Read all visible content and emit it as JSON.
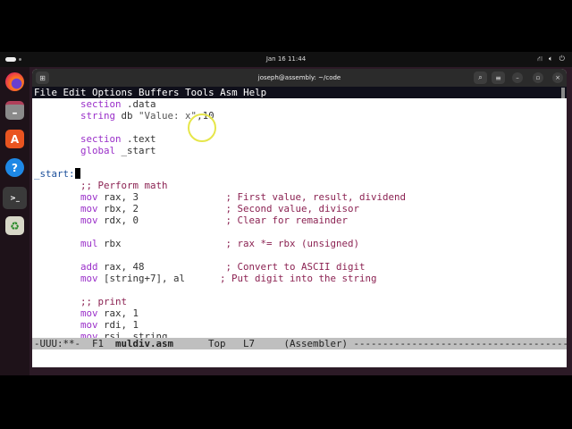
{
  "top_panel": {
    "clock": "Jan 16  11:44",
    "network_icon": "network-icon",
    "volume_icon": "volume-icon",
    "power_icon": "power-icon"
  },
  "dock": [
    {
      "name": "firefox"
    },
    {
      "name": "files"
    },
    {
      "name": "app-center"
    },
    {
      "name": "help"
    },
    {
      "name": "terminal"
    },
    {
      "name": "trash"
    }
  ],
  "window": {
    "title": "joseph@assembly: ~/code"
  },
  "menu": [
    "File",
    "Edit",
    "Options",
    "Buffers",
    "Tools",
    "Asm",
    "Help"
  ],
  "code": [
    [
      {
        "t": "        "
      },
      {
        "t": "section",
        "c": "kw"
      },
      {
        "t": " .data"
      }
    ],
    [
      {
        "t": "        "
      },
      {
        "t": "string",
        "c": "kw"
      },
      {
        "t": " db "
      },
      {
        "t": "\"Value: x\"",
        "c": "st"
      },
      {
        "t": ",10"
      }
    ],
    [],
    [
      {
        "t": "        "
      },
      {
        "t": "section",
        "c": "kw"
      },
      {
        "t": " .text"
      }
    ],
    [
      {
        "t": "        "
      },
      {
        "t": "global",
        "c": "kw"
      },
      {
        "t": " _start"
      }
    ],
    [],
    [
      {
        "t": "_start:",
        "c": "lb"
      }
    ],
    [
      {
        "t": "        "
      },
      {
        "t": ";; Perform math",
        "c": "cm"
      }
    ],
    [
      {
        "t": "        "
      },
      {
        "t": "mov",
        "c": "kw"
      },
      {
        "t": " rax, 3               "
      },
      {
        "t": "; First value, result, dividend",
        "c": "cm"
      }
    ],
    [
      {
        "t": "        "
      },
      {
        "t": "mov",
        "c": "kw"
      },
      {
        "t": " rbx, 2               "
      },
      {
        "t": "; Second value, divisor",
        "c": "cm"
      }
    ],
    [
      {
        "t": "        "
      },
      {
        "t": "mov",
        "c": "kw"
      },
      {
        "t": " rdx, 0               "
      },
      {
        "t": "; Clear for remainder",
        "c": "cm"
      }
    ],
    [],
    [
      {
        "t": "        "
      },
      {
        "t": "mul",
        "c": "kw"
      },
      {
        "t": " rbx                  "
      },
      {
        "t": "; rax *= rbx (unsigned)",
        "c": "cm"
      }
    ],
    [],
    [
      {
        "t": "        "
      },
      {
        "t": "add",
        "c": "kw"
      },
      {
        "t": " rax, 48              "
      },
      {
        "t": "; Convert to ASCII digit",
        "c": "cm"
      }
    ],
    [
      {
        "t": "        "
      },
      {
        "t": "mov",
        "c": "kw"
      },
      {
        "t": " [string+7], al      "
      },
      {
        "t": "; Put digit into the string",
        "c": "cm"
      }
    ],
    [],
    [
      {
        "t": "        "
      },
      {
        "t": ";; print",
        "c": "cm"
      }
    ],
    [
      {
        "t": "        "
      },
      {
        "t": "mov",
        "c": "kw"
      },
      {
        "t": " rax, 1"
      }
    ],
    [
      {
        "t": "        "
      },
      {
        "t": "mov",
        "c": "kw"
      },
      {
        "t": " rdi, 1"
      }
    ],
    [
      {
        "t": "        "
      },
      {
        "t": "mov",
        "c": "kw"
      },
      {
        "t": " rsi, string"
      }
    ]
  ],
  "modeline": {
    "status": "-UUU:**-  F1  ",
    "buffer": "muldiv.asm",
    "position": "      Top   L7     ",
    "mode": "(Assembler) ---------------------------------------------------------"
  }
}
